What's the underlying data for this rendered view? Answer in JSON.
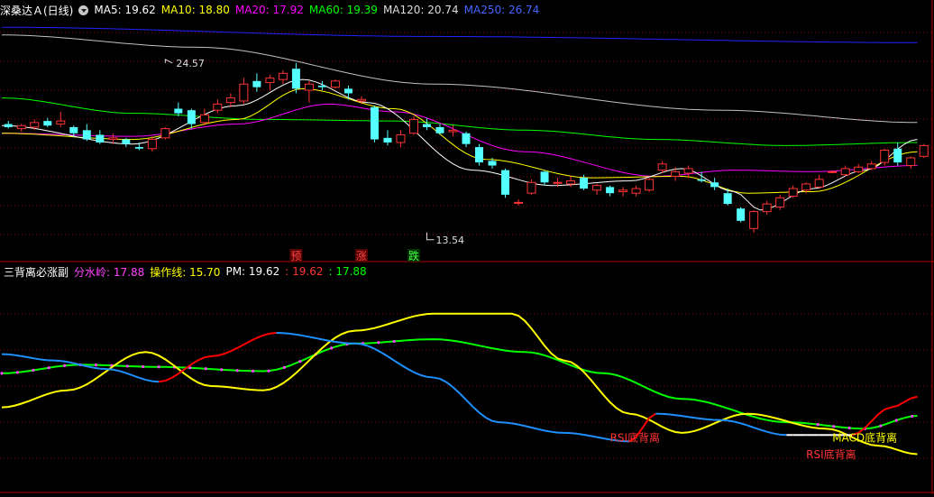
{
  "main_header": {
    "title": "深桑达Ａ(日线)",
    "ma": [
      {
        "label": "MA5: 19.62",
        "color": "#ffffff"
      },
      {
        "label": "MA10: 18.80",
        "color": "#ffff00"
      },
      {
        "label": "MA20: 17.92",
        "color": "#ff00ff"
      },
      {
        "label": "MA60: 19.39",
        "color": "#00ff00"
      },
      {
        "label": "MA120: 20.74",
        "color": "#dddddd"
      },
      {
        "label": "MA250: 26.74",
        "color": "#4466ff"
      }
    ]
  },
  "sub_header": {
    "title": "三背离必涨副",
    "items": [
      {
        "label": "分水岭: 17.88",
        "color": "#ff44ff"
      },
      {
        "label": "操作线: 15.70",
        "color": "#ffff00"
      },
      {
        "label": "PM: 19.62",
        "color": "#ffffff"
      },
      {
        "label": ": 19.62",
        "color": "#ff3333"
      },
      {
        "label": ": 17.88",
        "color": "#00ff00"
      }
    ]
  },
  "colors": {
    "up": "#ff3333",
    "down": "#54ffff",
    "grid": "#8b0000",
    "ma5": "#ffffff",
    "ma10": "#ffff00",
    "ma20": "#ff00ff",
    "ma60": "#00ff00",
    "ma120": "#c0c0c0",
    "ma250": "#2222ff",
    "rsi_line": "#ff0000",
    "rsi_down": "#1e90ff",
    "rsi_white": "#ffffff",
    "yellow": "#ffff00",
    "green": "#00ff00",
    "dots": "#ff44ff"
  },
  "chart_data": [
    {
      "type": "candlestick",
      "title": "深桑达Ａ(日线)",
      "ylim": [
        12.0,
        27.5
      ],
      "annotations": [
        {
          "text": "24.57",
          "x_index": 12,
          "y": 24.57,
          "kind": "high"
        },
        {
          "text": "13.54",
          "x_index": 32,
          "y": 13.54,
          "kind": "low"
        }
      ],
      "markers": [
        {
          "text": "预",
          "x_index": 22,
          "color": "#ff4444",
          "bg": "#550000"
        },
        {
          "text": "涨",
          "x_index": 27,
          "color": "#ff4444",
          "bg": "#550000"
        },
        {
          "text": "跌",
          "x_index": 31,
          "color": "#44ff44",
          "bg": "#003300"
        }
      ],
      "candles": [
        [
          20.6,
          20.8,
          20.3,
          20.4
        ],
        [
          20.3,
          20.6,
          20.1,
          20.5
        ],
        [
          20.4,
          20.9,
          20.2,
          20.7
        ],
        [
          20.8,
          21.0,
          20.4,
          20.5
        ],
        [
          20.6,
          21.4,
          20.4,
          20.8
        ],
        [
          20.4,
          20.5,
          19.8,
          20.0
        ],
        [
          20.2,
          20.6,
          19.5,
          19.6
        ],
        [
          19.9,
          20.2,
          19.3,
          19.4
        ],
        [
          19.6,
          20.0,
          19.3,
          19.7
        ],
        [
          19.6,
          19.7,
          19.1,
          19.3
        ],
        [
          19.1,
          19.4,
          18.9,
          19.0
        ],
        [
          19.0,
          19.8,
          18.8,
          19.6
        ],
        [
          19.7,
          20.4,
          19.6,
          20.3
        ],
        [
          21.6,
          22.0,
          21.1,
          21.3
        ],
        [
          21.5,
          21.6,
          20.3,
          20.6
        ],
        [
          20.7,
          21.6,
          20.5,
          21.2
        ],
        [
          21.5,
          22.2,
          21.3,
          21.9
        ],
        [
          22.0,
          22.6,
          21.7,
          22.3
        ],
        [
          22.1,
          23.6,
          21.9,
          23.2
        ],
        [
          23.4,
          23.9,
          22.7,
          23.0
        ],
        [
          23.3,
          23.8,
          22.8,
          23.6
        ],
        [
          23.5,
          24.1,
          23.2,
          23.9
        ],
        [
          24.2,
          24.57,
          22.6,
          22.9
        ],
        [
          22.8,
          23.4,
          22.0,
          23.2
        ],
        [
          23.1,
          23.4,
          22.8,
          23.0
        ],
        [
          23.0,
          23.5,
          22.9,
          23.4
        ],
        [
          22.9,
          23.1,
          22.2,
          22.6
        ],
        [
          22.1,
          22.4,
          21.9,
          22.2
        ],
        [
          21.7,
          21.8,
          19.4,
          19.6
        ],
        [
          19.7,
          20.2,
          19.2,
          19.4
        ],
        [
          19.4,
          20.2,
          19.1,
          19.9
        ],
        [
          20.0,
          21.1,
          19.9,
          20.9
        ],
        [
          20.6,
          21.0,
          20.2,
          20.4
        ]
      ],
      "candles_b": [
        [
          20.4,
          20.6,
          19.9,
          20.0
        ],
        [
          20.1,
          20.5,
          19.8,
          20.2
        ],
        [
          20.0,
          20.1,
          19.1,
          19.3
        ],
        [
          19.1,
          19.3,
          17.9,
          18.1
        ],
        [
          18.2,
          18.4,
          17.7,
          17.9
        ],
        [
          17.6,
          17.7,
          15.8,
          16.0
        ],
        [
          15.5,
          15.7,
          15.3,
          15.5
        ],
        [
          16.1,
          17.0,
          16.0,
          16.8
        ],
        [
          17.5,
          17.6,
          16.6,
          16.8
        ],
        [
          16.8,
          17.1,
          16.5,
          16.8
        ],
        [
          16.7,
          17.2,
          16.5,
          16.9
        ],
        [
          17.1,
          17.3,
          16.3,
          16.4
        ],
        [
          16.3,
          16.7,
          16.0,
          16.6
        ],
        [
          16.5,
          16.6,
          15.9,
          16.1
        ],
        [
          16.2,
          16.5,
          15.9,
          16.3
        ],
        [
          16.1,
          16.6,
          15.9,
          16.4
        ],
        [
          16.3,
          17.1,
          16.2,
          17.0
        ],
        [
          17.6,
          18.2,
          17.4,
          18.0
        ],
        [
          17.2,
          17.8,
          16.9,
          17.5
        ],
        [
          17.4,
          17.9,
          17.1,
          17.7
        ],
        [
          17.0,
          17.5,
          16.8,
          16.9
        ],
        [
          16.8,
          17.1,
          16.3,
          16.5
        ],
        [
          16.1,
          16.4,
          15.3,
          15.4
        ],
        [
          15.1,
          15.2,
          14.2,
          14.3
        ],
        [
          13.8,
          15.0,
          13.54,
          14.9
        ],
        [
          14.9,
          15.6,
          14.7,
          15.4
        ],
        [
          15.2,
          16.0,
          15.0,
          15.8
        ],
        [
          15.9,
          16.6,
          15.8,
          16.4
        ],
        [
          16.3,
          16.8,
          16.1,
          16.7
        ],
        [
          16.5,
          17.3,
          16.4,
          17.0
        ],
        [
          17.5,
          17.6,
          17.4,
          17.5
        ],
        [
          17.3,
          17.9,
          17.2,
          17.7
        ],
        [
          17.5,
          18.0,
          17.4,
          17.8
        ],
        [
          17.7,
          18.2,
          17.6,
          18.0
        ],
        [
          18.1,
          19.0,
          17.9,
          18.9
        ],
        [
          19.0,
          19.4,
          17.9,
          18.1
        ],
        [
          17.9,
          18.5,
          17.7,
          18.4
        ],
        [
          18.5,
          19.3,
          18.4,
          19.2
        ]
      ],
      "ma_series": {
        "ma250": [
          [
            0,
            26.9
          ],
          [
            33,
            26.3
          ],
          [
            70,
            25.9
          ]
        ],
        "ma120": [
          [
            0,
            26.4
          ],
          [
            15,
            25.6
          ],
          [
            33,
            23.2
          ],
          [
            55,
            21.5
          ],
          [
            70,
            20.7
          ]
        ],
        "ma60": [
          [
            0,
            22.3
          ],
          [
            10,
            21.3
          ],
          [
            20,
            20.9
          ],
          [
            30,
            20.8
          ],
          [
            40,
            20.2
          ],
          [
            50,
            19.6
          ],
          [
            60,
            19.2
          ],
          [
            70,
            19.4
          ]
        ],
        "ma20": [
          [
            0,
            20.0
          ],
          [
            10,
            19.8
          ],
          [
            18,
            20.6
          ],
          [
            25,
            21.9
          ],
          [
            30,
            21.4
          ],
          [
            40,
            18.8
          ],
          [
            50,
            17.2
          ],
          [
            56,
            17.6
          ],
          [
            62,
            17.5
          ],
          [
            70,
            17.9
          ]
        ],
        "ma10": [
          [
            0,
            20.0
          ],
          [
            10,
            19.6
          ],
          [
            18,
            20.9
          ],
          [
            23,
            22.9
          ],
          [
            30,
            21.6
          ],
          [
            37,
            18.3
          ],
          [
            45,
            17.1
          ],
          [
            52,
            17.2
          ],
          [
            57,
            16.1
          ],
          [
            62,
            16.2
          ],
          [
            70,
            18.8
          ]
        ],
        "ma5": [
          [
            0,
            20.5
          ],
          [
            10,
            19.3
          ],
          [
            18,
            21.8
          ],
          [
            23,
            23.5
          ],
          [
            28,
            22.0
          ],
          [
            36,
            17.6
          ],
          [
            42,
            16.6
          ],
          [
            48,
            16.9
          ],
          [
            52,
            17.7
          ],
          [
            56,
            16.2
          ],
          [
            58,
            15.0
          ],
          [
            62,
            16.4
          ],
          [
            66,
            17.6
          ],
          [
            70,
            19.6
          ]
        ]
      }
    },
    {
      "type": "line",
      "title": "三背离必涨副",
      "ylim": [
        0,
        100
      ],
      "annotations": [
        {
          "text": "RSI底背离",
          "x_index": 46,
          "y": 24,
          "color": "#ff3333"
        },
        {
          "text": "MACD底背离",
          "x_index": 63,
          "y": 24,
          "color": "#ffff00"
        },
        {
          "text": "RSI底背离",
          "x_index": 61,
          "y": 16,
          "color": "#ff3333"
        }
      ],
      "series": [
        {
          "name": "分水岭",
          "values": [
            [
              0,
              56
            ],
            [
              6,
              60
            ],
            [
              12,
              59
            ],
            [
              20,
              57
            ],
            [
              27,
              70
            ],
            [
              33,
              72
            ],
            [
              40,
              66
            ],
            [
              46,
              56
            ],
            [
              52,
              44
            ],
            [
              60,
              33
            ],
            [
              66,
              30
            ],
            [
              70,
              36
            ]
          ]
        },
        {
          "name": "操作线",
          "values": [
            [
              0,
              40
            ],
            [
              5,
              48
            ],
            [
              11,
              66
            ],
            [
              16,
              50
            ],
            [
              20,
              48
            ],
            [
              27,
              76
            ],
            [
              33,
              84
            ],
            [
              39,
              84
            ],
            [
              43,
              62
            ],
            [
              48,
              37
            ],
            [
              52,
              28
            ],
            [
              57,
              37
            ],
            [
              63,
              30
            ],
            [
              67,
              22
            ],
            [
              70,
              18
            ]
          ]
        },
        {
          "name": "PM",
          "values": [
            [
              0,
              65
            ],
            [
              4,
              62
            ],
            [
              8,
              58
            ],
            [
              12,
              52
            ],
            [
              16,
              64
            ],
            [
              21,
              75
            ],
            [
              27,
              70
            ],
            [
              33,
              54
            ],
            [
              38,
              33
            ],
            [
              43,
              28
            ],
            [
              48,
              24
            ],
            [
              50,
              37
            ],
            [
              55,
              34
            ],
            [
              60,
              27
            ],
            [
              65,
              27
            ],
            [
              68,
              40
            ],
            [
              70,
              45
            ]
          ]
        }
      ]
    }
  ]
}
